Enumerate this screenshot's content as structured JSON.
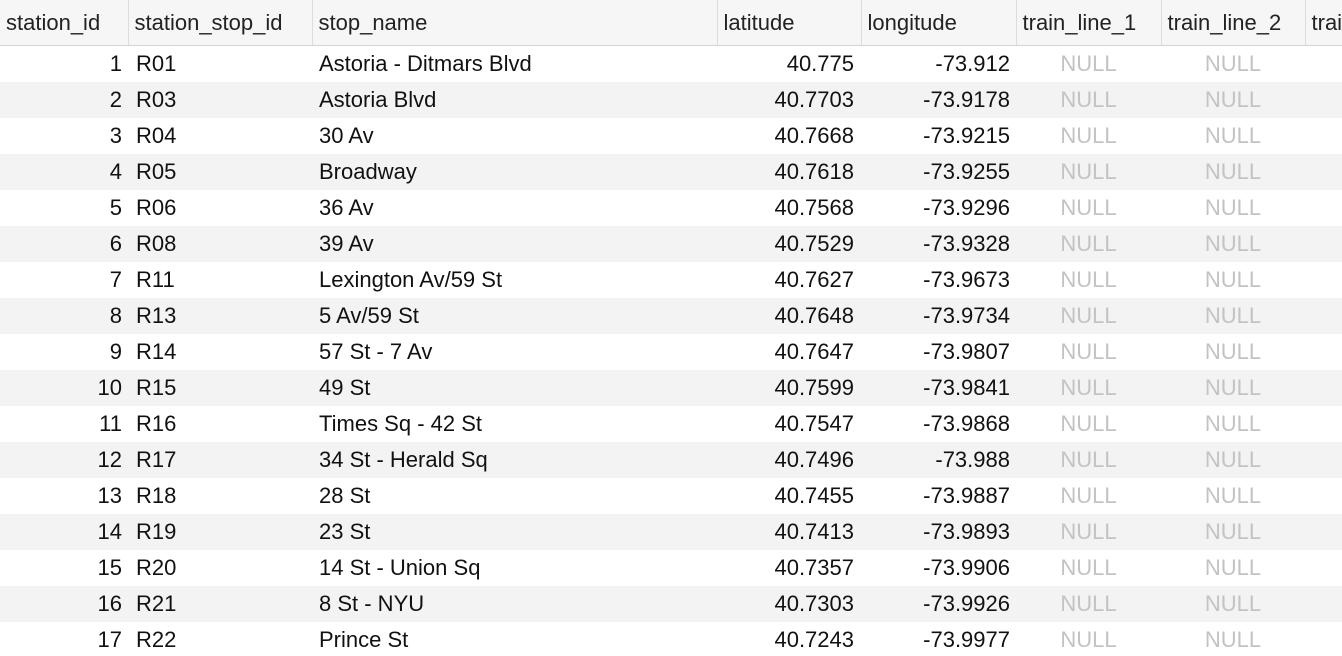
{
  "columns": [
    "station_id",
    "station_stop_id",
    "stop_name",
    "latitude",
    "longitude",
    "train_line_1",
    "train_line_2",
    "trai"
  ],
  "null_label": "NULL",
  "rows": [
    {
      "station_id": "1",
      "station_stop_id": "R01",
      "stop_name": "Astoria - Ditmars Blvd",
      "latitude": "40.775",
      "longitude": "-73.912",
      "train_line_1": "NULL",
      "train_line_2": "NULL"
    },
    {
      "station_id": "2",
      "station_stop_id": "R03",
      "stop_name": "Astoria Blvd",
      "latitude": "40.7703",
      "longitude": "-73.9178",
      "train_line_1": "NULL",
      "train_line_2": "NULL"
    },
    {
      "station_id": "3",
      "station_stop_id": "R04",
      "stop_name": "30 Av",
      "latitude": "40.7668",
      "longitude": "-73.9215",
      "train_line_1": "NULL",
      "train_line_2": "NULL"
    },
    {
      "station_id": "4",
      "station_stop_id": "R05",
      "stop_name": "Broadway",
      "latitude": "40.7618",
      "longitude": "-73.9255",
      "train_line_1": "NULL",
      "train_line_2": "NULL"
    },
    {
      "station_id": "5",
      "station_stop_id": "R06",
      "stop_name": "36 Av",
      "latitude": "40.7568",
      "longitude": "-73.9296",
      "train_line_1": "NULL",
      "train_line_2": "NULL"
    },
    {
      "station_id": "6",
      "station_stop_id": "R08",
      "stop_name": "39 Av",
      "latitude": "40.7529",
      "longitude": "-73.9328",
      "train_line_1": "NULL",
      "train_line_2": "NULL"
    },
    {
      "station_id": "7",
      "station_stop_id": "R11",
      "stop_name": "Lexington Av/59 St",
      "latitude": "40.7627",
      "longitude": "-73.9673",
      "train_line_1": "NULL",
      "train_line_2": "NULL"
    },
    {
      "station_id": "8",
      "station_stop_id": "R13",
      "stop_name": "5 Av/59 St",
      "latitude": "40.7648",
      "longitude": "-73.9734",
      "train_line_1": "NULL",
      "train_line_2": "NULL"
    },
    {
      "station_id": "9",
      "station_stop_id": "R14",
      "stop_name": "57 St - 7 Av",
      "latitude": "40.7647",
      "longitude": "-73.9807",
      "train_line_1": "NULL",
      "train_line_2": "NULL"
    },
    {
      "station_id": "10",
      "station_stop_id": "R15",
      "stop_name": "49 St",
      "latitude": "40.7599",
      "longitude": "-73.9841",
      "train_line_1": "NULL",
      "train_line_2": "NULL"
    },
    {
      "station_id": "11",
      "station_stop_id": "R16",
      "stop_name": "Times Sq - 42 St",
      "latitude": "40.7547",
      "longitude": "-73.9868",
      "train_line_1": "NULL",
      "train_line_2": "NULL"
    },
    {
      "station_id": "12",
      "station_stop_id": "R17",
      "stop_name": "34 St - Herald Sq",
      "latitude": "40.7496",
      "longitude": "-73.988",
      "train_line_1": "NULL",
      "train_line_2": "NULL"
    },
    {
      "station_id": "13",
      "station_stop_id": "R18",
      "stop_name": "28 St",
      "latitude": "40.7455",
      "longitude": "-73.9887",
      "train_line_1": "NULL",
      "train_line_2": "NULL"
    },
    {
      "station_id": "14",
      "station_stop_id": "R19",
      "stop_name": "23 St",
      "latitude": "40.7413",
      "longitude": "-73.9893",
      "train_line_1": "NULL",
      "train_line_2": "NULL"
    },
    {
      "station_id": "15",
      "station_stop_id": "R20",
      "stop_name": "14 St - Union Sq",
      "latitude": "40.7357",
      "longitude": "-73.9906",
      "train_line_1": "NULL",
      "train_line_2": "NULL"
    },
    {
      "station_id": "16",
      "station_stop_id": "R21",
      "stop_name": "8 St - NYU",
      "latitude": "40.7303",
      "longitude": "-73.9926",
      "train_line_1": "NULL",
      "train_line_2": "NULL"
    },
    {
      "station_id": "17",
      "station_stop_id": "R22",
      "stop_name": "Prince St",
      "latitude": "40.7243",
      "longitude": "-73.9977",
      "train_line_1": "NULL",
      "train_line_2": "NULL"
    }
  ],
  "colors": {
    "header_bg": "#f6f6f6",
    "row_alt_bg": "#f3f3f3",
    "null_text": "#c3c3c3",
    "text": "#111111"
  }
}
